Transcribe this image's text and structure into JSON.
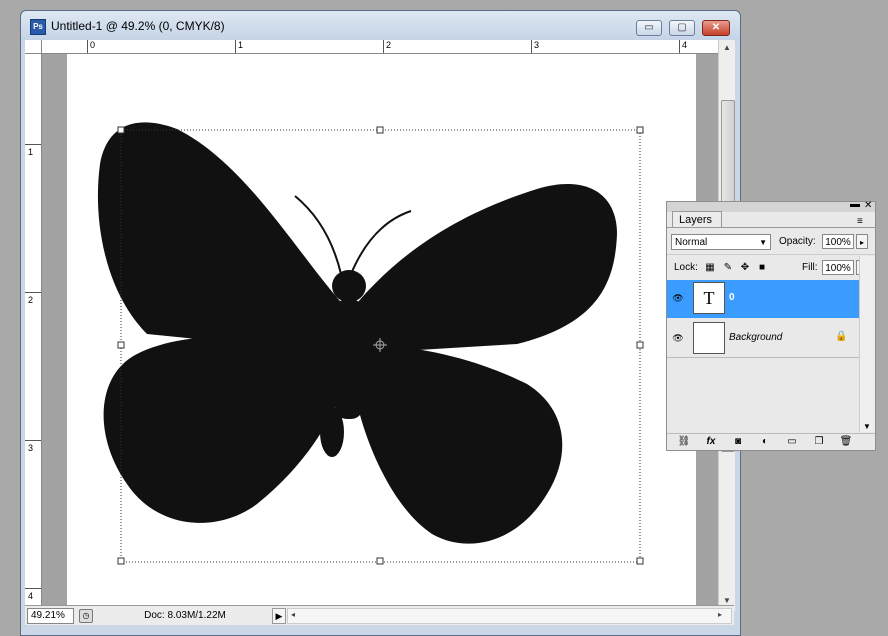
{
  "window": {
    "title": "Untitled-1 @ 49.2% (0, CMYK/8)",
    "app_icon_text": "Ps",
    "buttons": {
      "minimize": "▭",
      "maximize": "▢",
      "close": "✕"
    }
  },
  "rulers": {
    "top_labels": [
      "0",
      "1",
      "2",
      "3",
      "4"
    ],
    "left_labels": [
      "1",
      "2",
      "3",
      "4"
    ]
  },
  "status": {
    "zoom": "49.21%",
    "doc_info": "Doc: 8.03M/1.22M",
    "arrow": "▶",
    "scroll_left": "◂",
    "scroll_right": "▸"
  },
  "layers_panel": {
    "tab": "Layers",
    "tab_close": "✕",
    "blend_mode": "Normal",
    "opacity_label": "Opacity:",
    "opacity_value": "100%",
    "lock_label": "Lock:",
    "fill_label": "Fill:",
    "fill_value": "100%",
    "layers": [
      {
        "thumb": "T",
        "name": "0",
        "selected": true
      },
      {
        "thumb": "",
        "name": "Background",
        "locked": true
      }
    ],
    "footer_icons": [
      "link-icon",
      "fx-icon",
      "mask-icon",
      "adjustment-icon",
      "folder-icon",
      "new-layer-icon",
      "trash-icon"
    ]
  },
  "colors": {
    "selection": "#3b9cff",
    "shape": "#111111"
  }
}
